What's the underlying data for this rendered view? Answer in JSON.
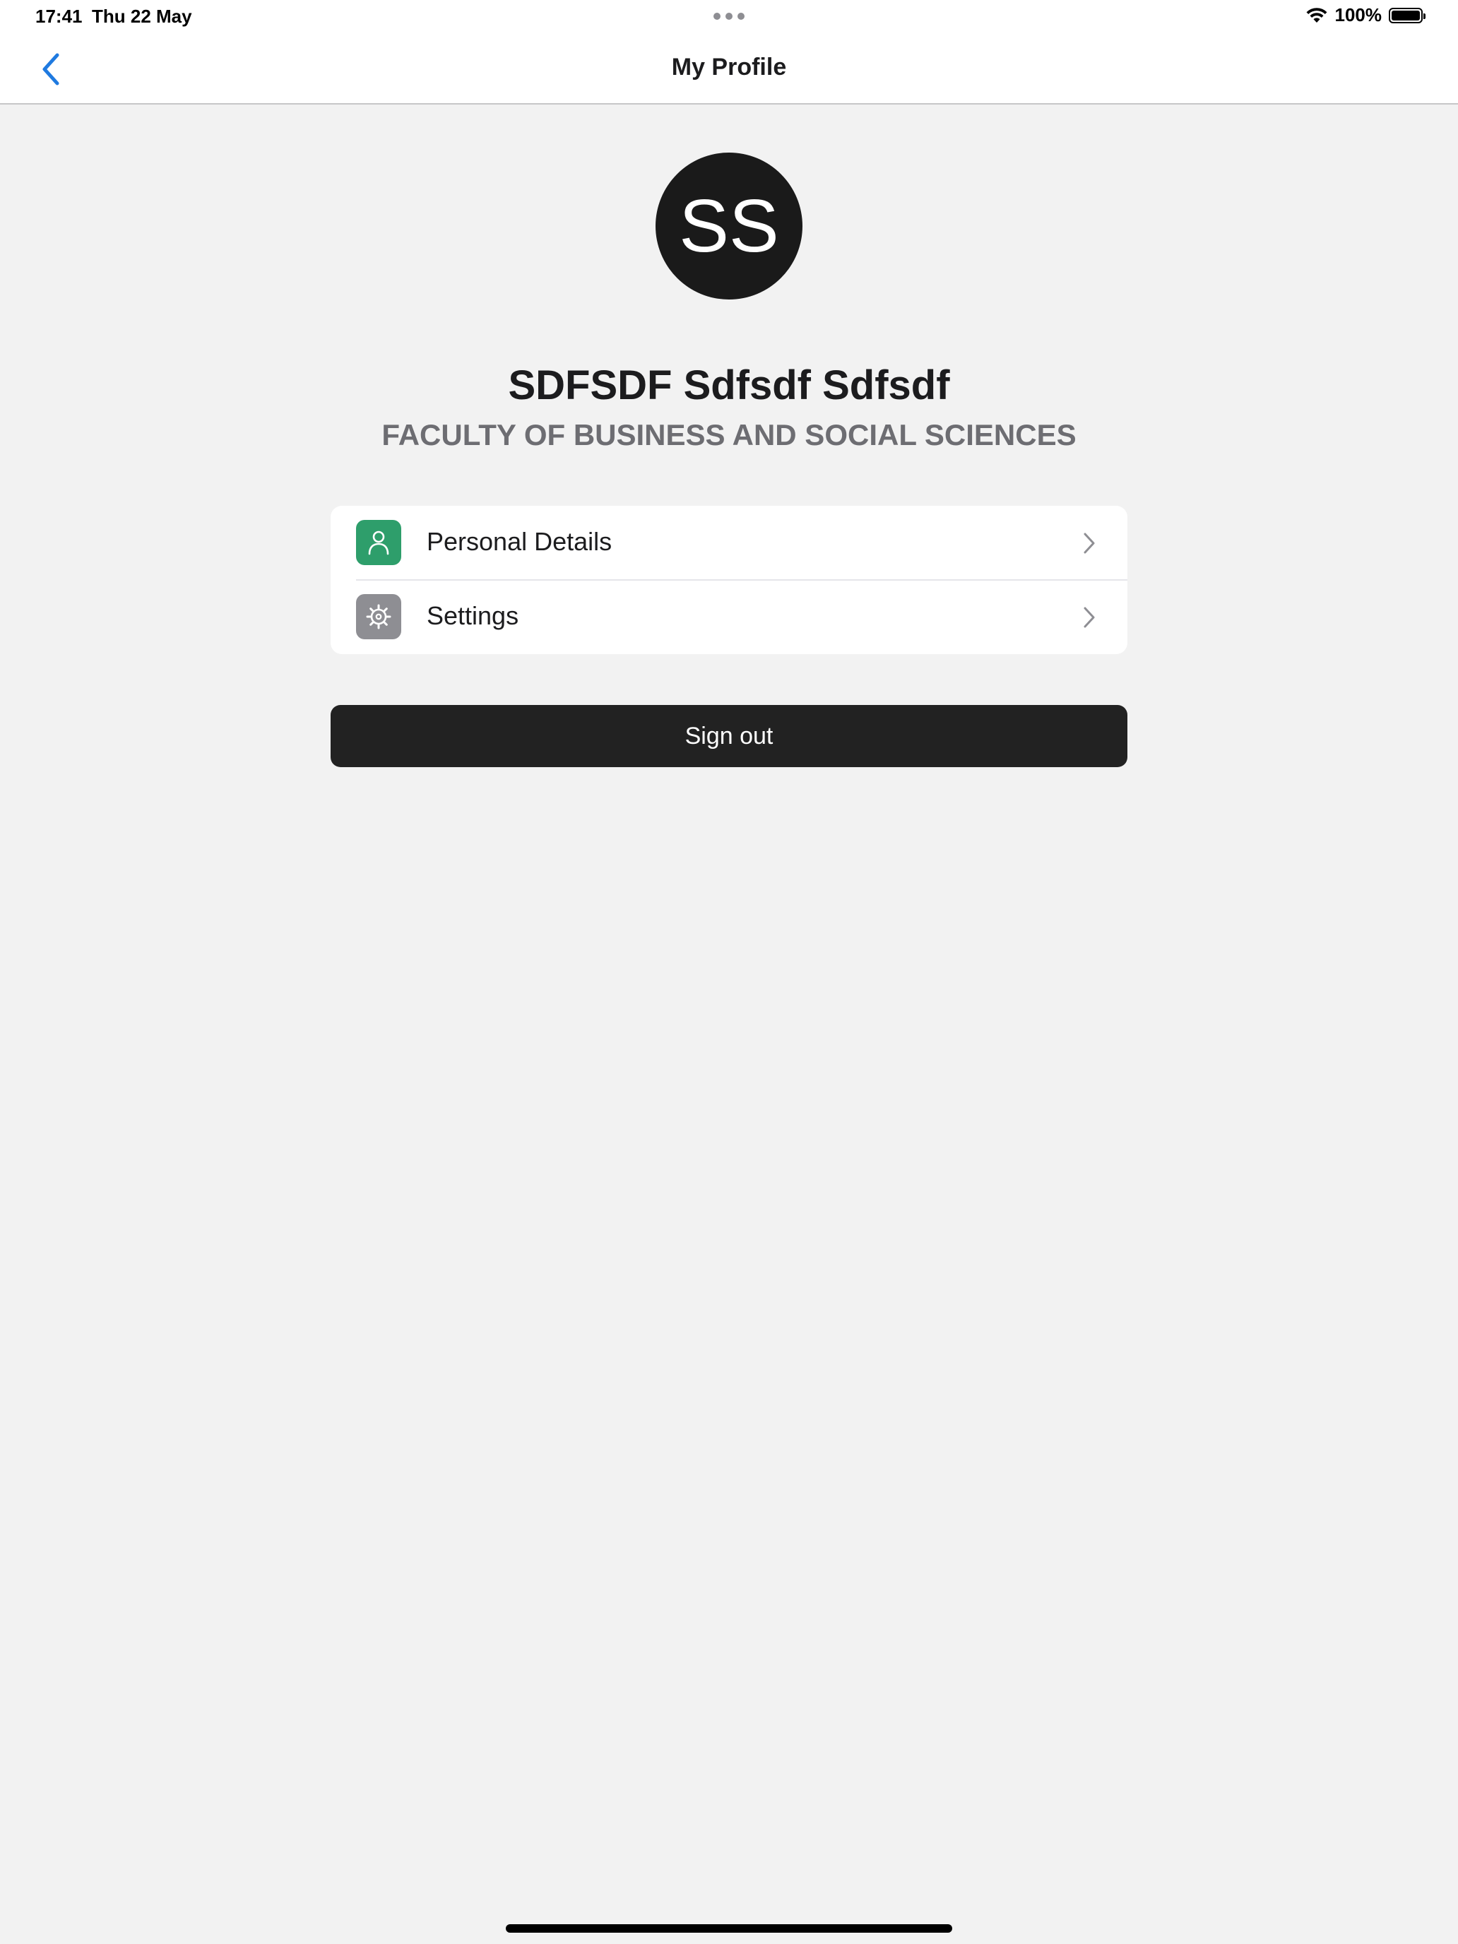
{
  "status_bar": {
    "time": "17:41",
    "date": "Thu 22 May",
    "battery": "100%"
  },
  "nav": {
    "title": "My Profile"
  },
  "profile": {
    "initials": "SS",
    "name": "SDFSDF Sdfsdf Sdfsdf",
    "faculty": "FACULTY OF BUSINESS AND SOCIAL SCIENCES"
  },
  "menu": {
    "items": [
      {
        "label": "Personal Details",
        "icon": "person-icon",
        "color": "#2e9e6b"
      },
      {
        "label": "Settings",
        "icon": "gear-icon",
        "color": "#8e8e93"
      }
    ]
  },
  "actions": {
    "sign_out": "Sign out"
  },
  "colors": {
    "accent": "#1f7ae0",
    "background": "#f2f2f2",
    "sign_out_bg": "#222222"
  }
}
